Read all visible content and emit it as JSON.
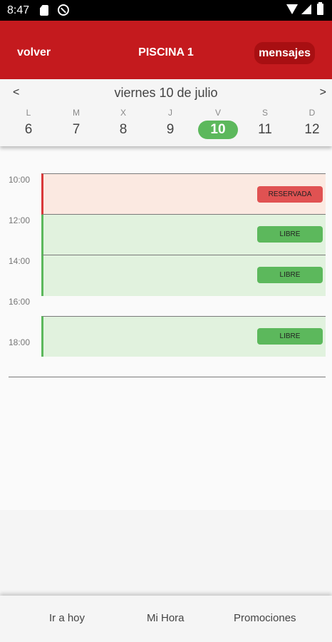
{
  "status_bar": {
    "time": "8:47",
    "icons": [
      "sim-card-icon",
      "vpn-icon",
      "wifi-icon",
      "signal-icon",
      "battery-icon"
    ]
  },
  "app_bar": {
    "back_label": "volver",
    "title": "PISCINA 1",
    "messages_label": "mensajes",
    "colors": {
      "background": "#c41a1e",
      "button": "#a80f12"
    }
  },
  "week": {
    "prev_label": "<",
    "next_label": ">",
    "date_title": "viernes 10 de julio",
    "selected_day": "10",
    "days": [
      {
        "letter": "L",
        "number": "6"
      },
      {
        "letter": "M",
        "number": "7"
      },
      {
        "letter": "X",
        "number": "8"
      },
      {
        "letter": "J",
        "number": "9"
      },
      {
        "letter": "V",
        "number": "10"
      },
      {
        "letter": "S",
        "number": "11"
      },
      {
        "letter": "D",
        "number": "12"
      }
    ],
    "colors": {
      "selected": "#5cb85c"
    }
  },
  "schedule": {
    "times": [
      "10:00",
      "12:00",
      "14:00",
      "16:00",
      "18:00"
    ],
    "slots": [
      {
        "status": "RESERVADA"
      },
      {
        "status": "LIBRE"
      },
      {
        "status": "LIBRE"
      },
      {
        "status": "LIBRE"
      }
    ],
    "colors": {
      "reserved": "#e05252",
      "free": "#5cb85c"
    }
  },
  "bottom_nav": {
    "items": [
      "Ir a hoy",
      "Mi Hora",
      "Promociones"
    ]
  }
}
